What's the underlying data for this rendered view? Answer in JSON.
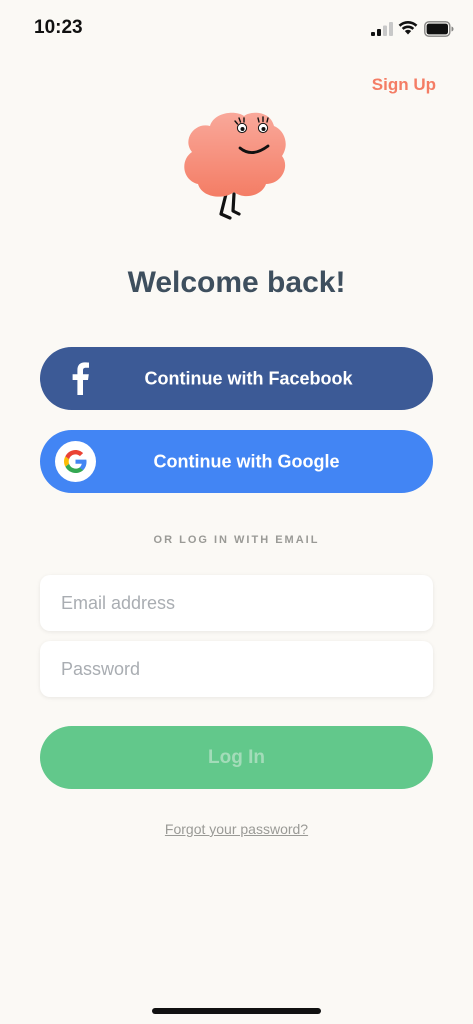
{
  "status_bar": {
    "time": "10:23",
    "icons": [
      "signal-icon",
      "wifi-icon",
      "battery-icon"
    ]
  },
  "header": {
    "signup_label": "Sign Up"
  },
  "mascot": {
    "icon": "pink-cloud-mascot"
  },
  "title": "Welcome back!",
  "social": {
    "facebook_label": "Continue with Facebook",
    "google_label": "Continue with Google"
  },
  "divider": "OR LOG IN WITH EMAIL",
  "form": {
    "email_placeholder": "Email address",
    "email_value": "",
    "password_placeholder": "Password",
    "password_value": "",
    "login_label": "Log In"
  },
  "forgot_label": "Forgot your password?",
  "colors": {
    "background": "#fbf9f5",
    "accent": "#f47d65",
    "heading": "#3e4f5e",
    "facebook": "#3c5a96",
    "google": "#4285f4",
    "login": "#62c88b",
    "muted": "#9a9a96"
  }
}
